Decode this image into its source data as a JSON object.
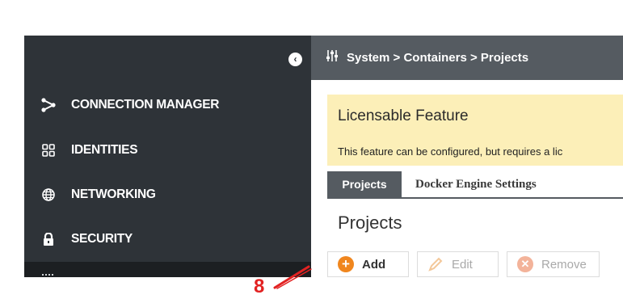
{
  "sidebar": {
    "collapse_icon": "chevron-left-circle-icon",
    "items": [
      {
        "label": "CONNECTION MANAGER",
        "icon": "share-nodes-icon"
      },
      {
        "label": "IDENTITIES",
        "icon": "grid-squares-icon"
      },
      {
        "label": "NETWORKING",
        "icon": "globe-icon"
      },
      {
        "label": "SECURITY",
        "icon": "lock-icon"
      }
    ]
  },
  "header": {
    "icon": "sliders-icon",
    "breadcrumb": "System > Containers > Projects"
  },
  "license": {
    "title": "Licensable Feature",
    "text": "This feature can be configured, but requires a lic"
  },
  "tabs": [
    {
      "label": "Projects",
      "active": true
    },
    {
      "label": "Docker Engine Settings",
      "active": false
    }
  ],
  "section": {
    "title": "Projects"
  },
  "toolbar": {
    "add_label": "Add",
    "edit_label": "Edit",
    "remove_label": "Remove"
  },
  "annotation": {
    "number": "8",
    "color": "#e22222"
  },
  "colors": {
    "sidebar_bg": "#2e3338",
    "header_bg": "#555b61",
    "license_bg": "#fcefb8",
    "accent_orange": "#f0861e"
  }
}
